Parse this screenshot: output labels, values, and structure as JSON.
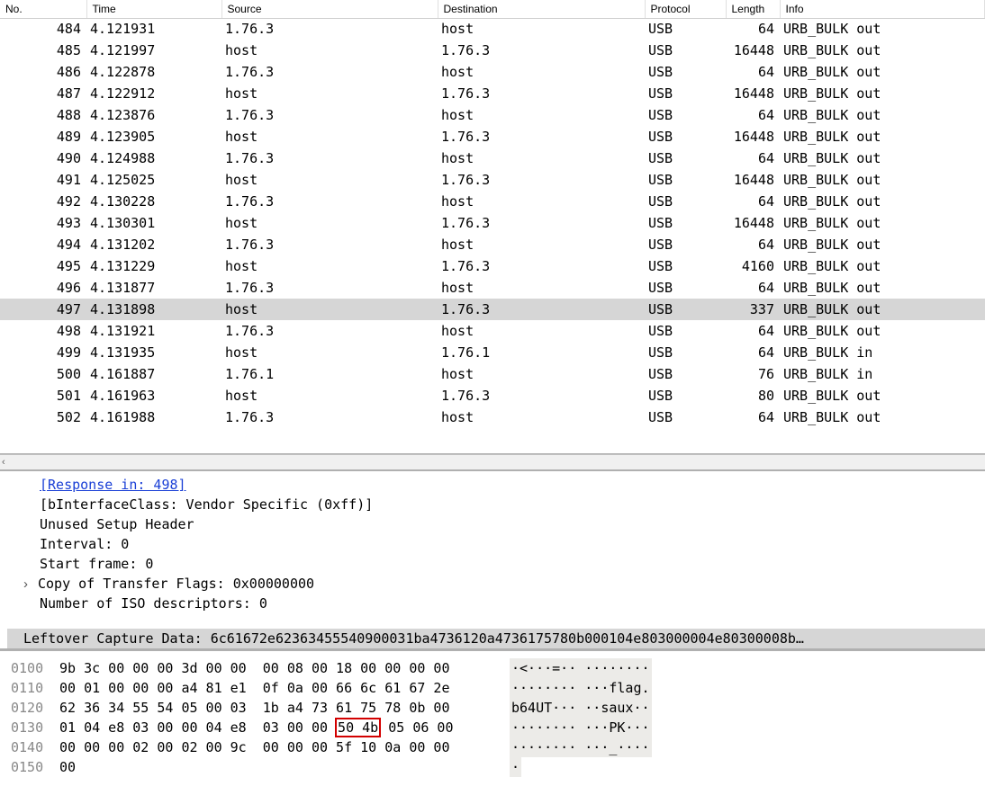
{
  "columns": {
    "no": "No.",
    "time": "Time",
    "source": "Source",
    "destination": "Destination",
    "protocol": "Protocol",
    "length": "Length",
    "info": "Info"
  },
  "packets": [
    {
      "no": "484",
      "time": "4.121931",
      "src": "1.76.3",
      "dst": "host",
      "proto": "USB",
      "len": "64",
      "info": "URB_BULK out"
    },
    {
      "no": "485",
      "time": "4.121997",
      "src": "host",
      "dst": "1.76.3",
      "proto": "USB",
      "len": "16448",
      "info": "URB_BULK out"
    },
    {
      "no": "486",
      "time": "4.122878",
      "src": "1.76.3",
      "dst": "host",
      "proto": "USB",
      "len": "64",
      "info": "URB_BULK out"
    },
    {
      "no": "487",
      "time": "4.122912",
      "src": "host",
      "dst": "1.76.3",
      "proto": "USB",
      "len": "16448",
      "info": "URB_BULK out"
    },
    {
      "no": "488",
      "time": "4.123876",
      "src": "1.76.3",
      "dst": "host",
      "proto": "USB",
      "len": "64",
      "info": "URB_BULK out"
    },
    {
      "no": "489",
      "time": "4.123905",
      "src": "host",
      "dst": "1.76.3",
      "proto": "USB",
      "len": "16448",
      "info": "URB_BULK out"
    },
    {
      "no": "490",
      "time": "4.124988",
      "src": "1.76.3",
      "dst": "host",
      "proto": "USB",
      "len": "64",
      "info": "URB_BULK out"
    },
    {
      "no": "491",
      "time": "4.125025",
      "src": "host",
      "dst": "1.76.3",
      "proto": "USB",
      "len": "16448",
      "info": "URB_BULK out"
    },
    {
      "no": "492",
      "time": "4.130228",
      "src": "1.76.3",
      "dst": "host",
      "proto": "USB",
      "len": "64",
      "info": "URB_BULK out"
    },
    {
      "no": "493",
      "time": "4.130301",
      "src": "host",
      "dst": "1.76.3",
      "proto": "USB",
      "len": "16448",
      "info": "URB_BULK out"
    },
    {
      "no": "494",
      "time": "4.131202",
      "src": "1.76.3",
      "dst": "host",
      "proto": "USB",
      "len": "64",
      "info": "URB_BULK out"
    },
    {
      "no": "495",
      "time": "4.131229",
      "src": "host",
      "dst": "1.76.3",
      "proto": "USB",
      "len": "4160",
      "info": "URB_BULK out"
    },
    {
      "no": "496",
      "time": "4.131877",
      "src": "1.76.3",
      "dst": "host",
      "proto": "USB",
      "len": "64",
      "info": "URB_BULK out"
    },
    {
      "no": "497",
      "time": "4.131898",
      "src": "host",
      "dst": "1.76.3",
      "proto": "USB",
      "len": "337",
      "info": "URB_BULK out",
      "selected": true
    },
    {
      "no": "498",
      "time": "4.131921",
      "src": "1.76.3",
      "dst": "host",
      "proto": "USB",
      "len": "64",
      "info": "URB_BULK out"
    },
    {
      "no": "499",
      "time": "4.131935",
      "src": "host",
      "dst": "1.76.1",
      "proto": "USB",
      "len": "64",
      "info": "URB_BULK in"
    },
    {
      "no": "500",
      "time": "4.161887",
      "src": "1.76.1",
      "dst": "host",
      "proto": "USB",
      "len": "76",
      "info": "URB_BULK in"
    },
    {
      "no": "501",
      "time": "4.161963",
      "src": "host",
      "dst": "1.76.3",
      "proto": "USB",
      "len": "80",
      "info": "URB_BULK out"
    },
    {
      "no": "502",
      "time": "4.161988",
      "src": "1.76.3",
      "dst": "host",
      "proto": "USB",
      "len": "64",
      "info": "URB_BULK out"
    }
  ],
  "details": {
    "response_in": "[Response in: 498]",
    "interface_class": "[bInterfaceClass: Vendor Specific (0xff)]",
    "unused_setup": "Unused Setup Header",
    "interval": "Interval: 0",
    "start_frame": "Start frame: 0",
    "transfer_flags": "Copy of Transfer Flags: 0x00000000",
    "iso_desc": "Number of ISO descriptors: 0",
    "leftover": "Leftover Capture Data: 6c61672e62363455540900031ba4736120a4736175780b000104e803000004e80300008b…"
  },
  "hex": [
    {
      "offset": "0100",
      "b1": "9b 3c 00 00 00 3d 00 00",
      "b2": "00 08 00 18 00 00 00 00",
      "ascii": "·<···=·· ········"
    },
    {
      "offset": "0110",
      "b1": "00 01 00 00 00 a4 81 e1",
      "b2": "0f 0a 00 66 6c 61 67 2e",
      "ascii": "········ ···flag."
    },
    {
      "offset": "0120",
      "b1": "62 36 34 55 54 05 00 03",
      "b2": "1b a4 73 61 75 78 0b 00",
      "ascii": "b64UT··· ··saux··"
    },
    {
      "offset": "0130",
      "b1": "01 04 e8 03 00 00 04 e8",
      "b2a": "03 00 00 ",
      "hl": "50 4b",
      "b2b": " 05 06 00",
      "ascii": "········ ···PK···"
    },
    {
      "offset": "0140",
      "b1": "00 00 00 02 00 02 00 9c",
      "b2": "00 00 00 5f 10 0a 00 00",
      "ascii": "········ ···_····"
    },
    {
      "offset": "0150",
      "b1": "00",
      "b2": "",
      "ascii": "·"
    }
  ],
  "scroll": {
    "left_glyph": "‹"
  }
}
